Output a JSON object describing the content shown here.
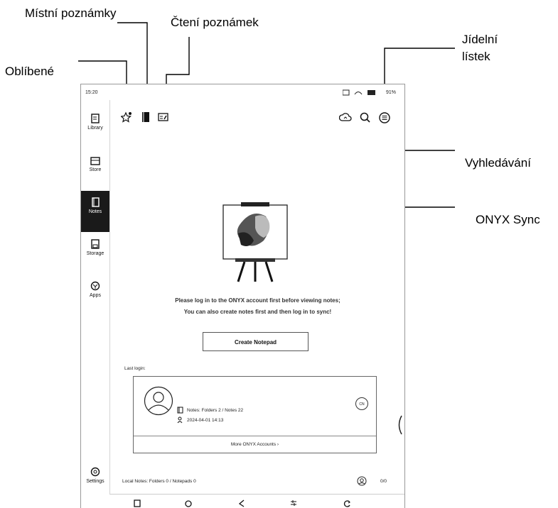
{
  "annotations": {
    "favorites": "Oblíbené",
    "local_notes": "Místní poznámky",
    "reading_notes": "Čtení poznámek",
    "menu": "Jídelní\nlístek",
    "menu_line1": "Jídelní",
    "menu_line2": "lístek",
    "search": "Vyhledávání",
    "sync": "ONYX Sync"
  },
  "status_bar": {
    "time": "15:20",
    "battery": "91%"
  },
  "sidebar": {
    "items": [
      {
        "label": "Library",
        "icon": "library-icon"
      },
      {
        "label": "Store",
        "icon": "store-icon"
      },
      {
        "label": "Notes",
        "icon": "notes-icon",
        "active": true
      },
      {
        "label": "Storage",
        "icon": "storage-icon"
      },
      {
        "label": "Apps",
        "icon": "apps-icon"
      }
    ],
    "settings_label": "Settings"
  },
  "main": {
    "message_line1": "Please log in to the ONYX account first before viewing notes;",
    "message_line2": "You can also create notes first and then log in to sync!",
    "create_button": "Create Notepad",
    "last_login_label": "Last login:",
    "account": {
      "notes_info": "Notes: Folders 2 / Notes 22",
      "datetime": "2024-04-01 14:13",
      "region_badge": "CN",
      "more_accounts": "More ONYX Accounts"
    },
    "footer_local_notes": "Local Notes: Folders 0 / Notepads 0",
    "footer_count": "0/0"
  },
  "colors": {
    "active_bg": "#1a1a1a",
    "border": "#666666"
  }
}
